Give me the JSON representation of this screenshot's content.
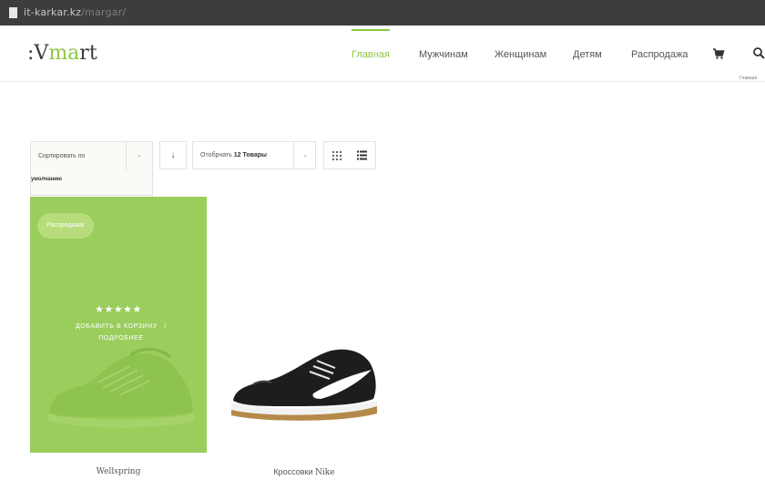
{
  "address_bar": {
    "host": "it-karkar.kz",
    "path": "/margar/"
  },
  "header": {
    "logo_prefix": ":V",
    "logo_accent": "ma",
    "logo_suffix": "rt",
    "accent_color": "#8ec63f",
    "nav": [
      {
        "label": "Главная",
        "active": true
      },
      {
        "label": "Мужчинам",
        "active": false
      },
      {
        "label": "Женщинам",
        "active": false
      },
      {
        "label": "Детям",
        "active": false
      },
      {
        "label": "Распродажа",
        "active": false
      }
    ],
    "cart_icon": "cart-icon",
    "search_icon": "search-icon",
    "breadcrumb": "Главная"
  },
  "toolbar": {
    "sort_label": "Сортировать по",
    "sort_value": "умолчанию",
    "sort_direction_icon": "arrow-down-icon",
    "show_label_prefix": "Отобрнать ",
    "show_label_count": "12 Товары",
    "view_grid_icon": "grid-icon",
    "view_list_icon": "list-icon"
  },
  "products": [
    {
      "title": "Wellspring",
      "badge": "Распродажа!",
      "rating_stars": 5,
      "stars_text": "★★★★★",
      "add_to_cart": "ДОБАВИТЬ В КОРЗИНУ",
      "separator": "/",
      "details": "ПОДРОБНЕЕ",
      "overlay_color": "#9acd5c"
    },
    {
      "title_prefix": "Кроссовки",
      "title_brand": "Nike"
    }
  ]
}
